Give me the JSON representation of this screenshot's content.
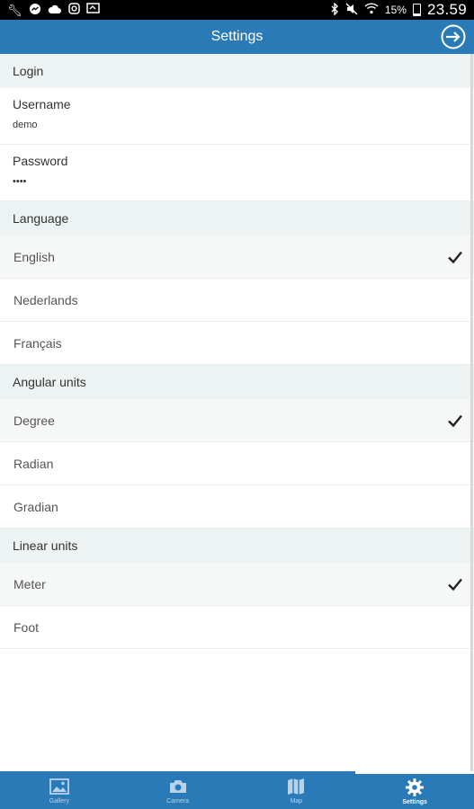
{
  "status_bar": {
    "left_icons": [
      "wrench-icon",
      "messenger-icon",
      "cloud-icon",
      "instagram-icon",
      "cast-icon"
    ],
    "right_icons": [
      "bluetooth-icon",
      "mute-icon",
      "wifi-icon",
      "battery-icon"
    ],
    "battery": "15%",
    "time": "23.59"
  },
  "header": {
    "title": "Settings",
    "action_icon": "logout-icon"
  },
  "sections": {
    "login": {
      "title": "Login",
      "username_label": "Username",
      "username_value": "demo",
      "password_label": "Password",
      "password_value": "••••"
    },
    "language": {
      "title": "Language",
      "options": [
        "English",
        "Nederlands",
        "Français"
      ],
      "selected": "English"
    },
    "angular": {
      "title": "Angular units",
      "options": [
        "Degree",
        "Radian",
        "Gradian"
      ],
      "selected": "Degree"
    },
    "linear": {
      "title": "Linear units",
      "options": [
        "Meter",
        "Foot"
      ],
      "selected": "Meter"
    }
  },
  "bottom_nav": {
    "tabs": [
      {
        "label": "Gallery",
        "icon": "gallery-icon"
      },
      {
        "label": "Camera",
        "icon": "camera-icon"
      },
      {
        "label": "Map",
        "icon": "map-icon"
      },
      {
        "label": "Settings",
        "icon": "gear-icon"
      }
    ],
    "active": "Settings"
  },
  "colors": {
    "primary": "#2a7ab8",
    "section_bg": "#edf2f2",
    "selected_bg": "#f6f7f7"
  }
}
